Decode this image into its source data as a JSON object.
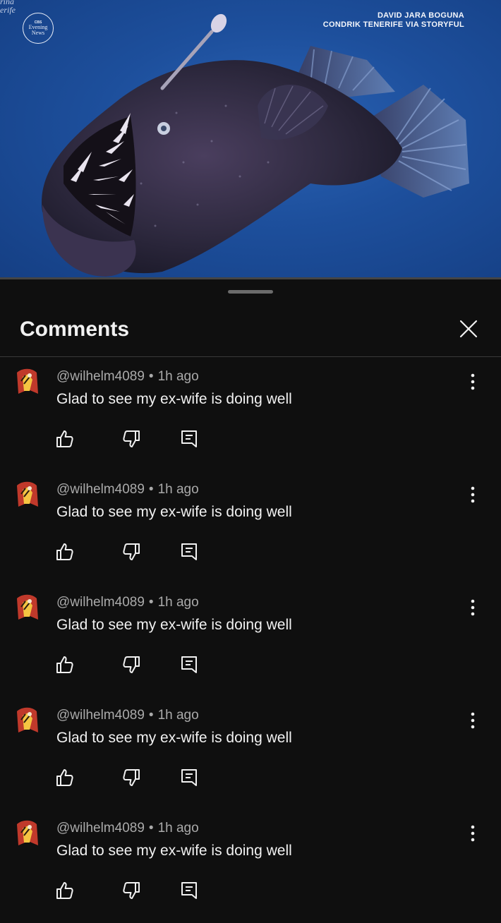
{
  "video": {
    "logo_top": "CBS",
    "logo_line1": "Evening",
    "logo_line2": "News",
    "corner_line1": "rina",
    "corner_line2": "erife",
    "credit_line1": "DAVID JARA BOGUNA",
    "credit_line2": "CONDRIK TENERIFE VIA STORYFUL"
  },
  "sheet": {
    "title": "Comments"
  },
  "comments": [
    {
      "author": "@wilhelm4089",
      "separator": "•",
      "time": "1h ago",
      "text": "Glad to see my ex-wife is doing well"
    },
    {
      "author": "@wilhelm4089",
      "separator": "•",
      "time": "1h ago",
      "text": "Glad to see my ex-wife is doing well"
    },
    {
      "author": "@wilhelm4089",
      "separator": "•",
      "time": "1h ago",
      "text": "Glad to see my ex-wife is doing well"
    },
    {
      "author": "@wilhelm4089",
      "separator": "•",
      "time": "1h ago",
      "text": "Glad to see my ex-wife is doing well"
    },
    {
      "author": "@wilhelm4089",
      "separator": "•",
      "time": "1h ago",
      "text": "Glad to see my ex-wife is doing well"
    }
  ],
  "icons": {
    "close": "close-icon",
    "more": "more-vert-icon",
    "like": "thumbs-up-icon",
    "dislike": "thumbs-down-icon",
    "reply": "reply-comment-icon"
  },
  "colors": {
    "background": "#0f0f0f",
    "text": "#f1f1f1",
    "meta": "#aaaaaa",
    "video_blue": "#1d4f9c"
  }
}
